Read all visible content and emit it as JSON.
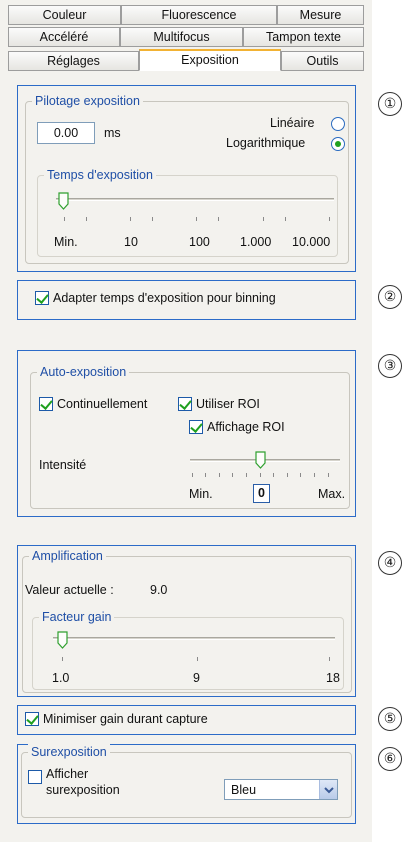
{
  "tabs": {
    "row1": [
      "Couleur",
      "Fluorescence",
      "Mesure"
    ],
    "row2": [
      "Accéléré",
      "Multifocus",
      "Tampon texte"
    ],
    "row3": [
      "Réglages",
      "Exposition",
      "Outils"
    ],
    "active": "Exposition"
  },
  "pilotage": {
    "title": "Pilotage exposition",
    "value": "0.00",
    "unit": "ms",
    "mode_linear": "Linéaire",
    "mode_log": "Logarithmique",
    "selected_mode": "Logarithmique",
    "slider_title": "Temps d'exposition",
    "slider_labels": [
      "Min.",
      "10",
      "100",
      "1.000",
      "10.000"
    ],
    "slider_level": 0.0
  },
  "binning": {
    "label": "Adapter temps d'exposition pour binning",
    "checked": true
  },
  "auto": {
    "title": "Auto-exposition",
    "continuous_label": "Continuellement",
    "continuous_checked": true,
    "use_roi_label": "Utiliser ROI",
    "use_roi_checked": true,
    "show_roi_label": "Affichage ROI",
    "show_roi_checked": true,
    "intensity_label": "Intensité",
    "min_label": "Min.",
    "max_label": "Max.",
    "intensity_value": "0",
    "slider_level": 0.5
  },
  "amplification": {
    "title": "Amplification",
    "current_label": "Valeur actuelle :",
    "current_value": "9.0",
    "gain_title": "Facteur gain",
    "gain_labels": [
      "1.0",
      "9",
      "18"
    ],
    "slider_level": 0.0
  },
  "minimize": {
    "label": "Minimiser gain durant capture",
    "checked": true
  },
  "overexposure": {
    "title": "Surexposition",
    "show_label_line1": "Afficher",
    "show_label_line2": "surexposition",
    "checked": false,
    "color_value": "Bleu"
  },
  "callouts": [
    "①",
    "②",
    "③",
    "④",
    "⑤",
    "⑥"
  ],
  "colors": {
    "panel_bg": "#f3f2ee",
    "group_title": "#1f4fa6",
    "callout_border": "#2c6bc8",
    "check_mark": "#1fa01f",
    "active_tab_accent": "#f2b233"
  }
}
